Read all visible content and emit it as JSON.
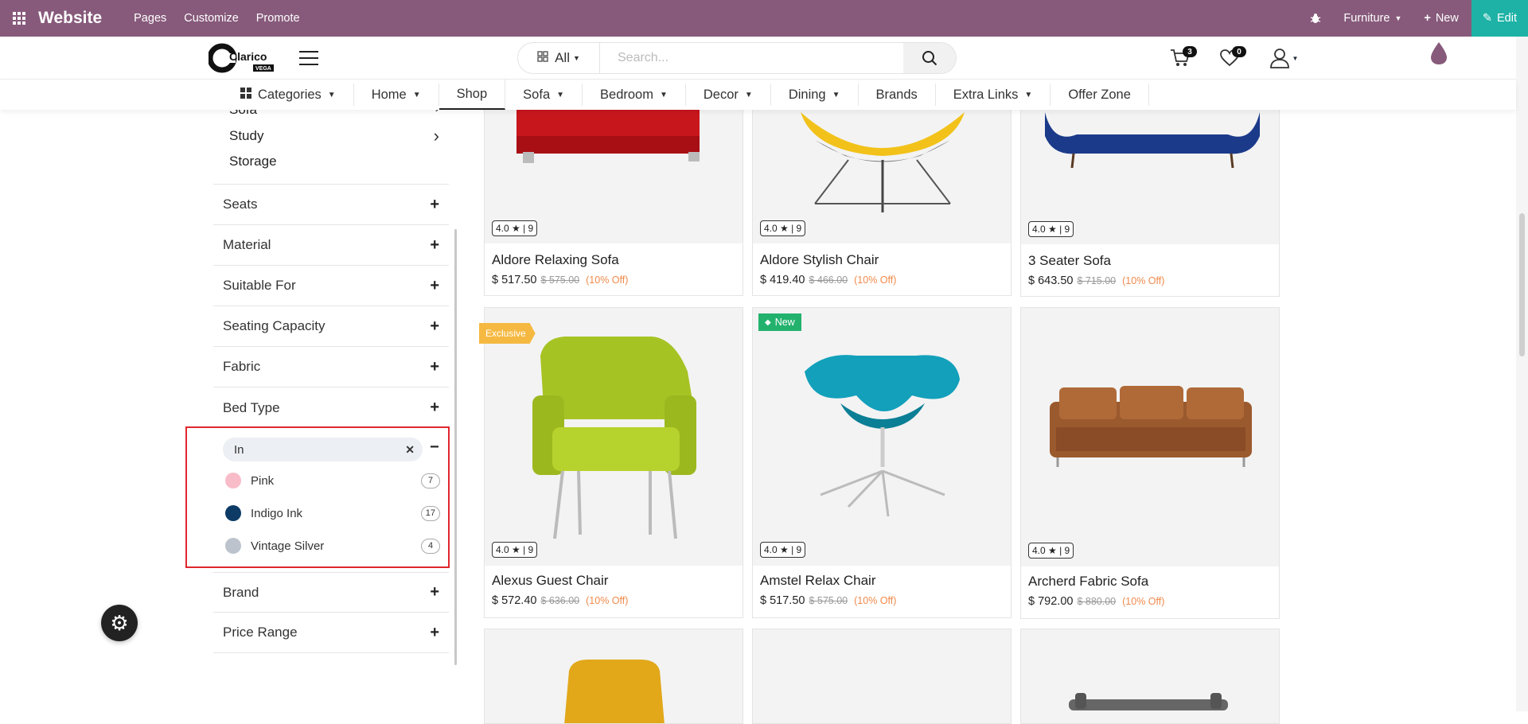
{
  "topbar": {
    "brand": "Website",
    "menu": [
      "Pages",
      "Customize",
      "Promote"
    ],
    "website_selector": "Furniture",
    "new_label": "New",
    "edit_label": "Edit",
    "color": "#875a7b",
    "edit_color": "#1eb2a6"
  },
  "header": {
    "logo_text": "Clarico",
    "logo_sub": "VEGA",
    "search_category": "All",
    "search_placeholder": "Search...",
    "cart_count": "3",
    "wishlist_count": "0"
  },
  "category_nav": [
    {
      "label": "Categories",
      "dropdown": true
    },
    {
      "label": "Home",
      "dropdown": true
    },
    {
      "label": "Shop",
      "dropdown": false,
      "active": true
    },
    {
      "label": "Sofa",
      "dropdown": true
    },
    {
      "label": "Bedroom",
      "dropdown": true
    },
    {
      "label": "Decor",
      "dropdown": true
    },
    {
      "label": "Dining",
      "dropdown": true
    },
    {
      "label": "Brands",
      "dropdown": false
    },
    {
      "label": "Extra Links",
      "dropdown": true
    },
    {
      "label": "Offer Zone",
      "dropdown": false
    }
  ],
  "sidebar": {
    "subcategories": [
      "Sofa",
      "Study",
      "Storage"
    ],
    "facets": [
      "Seats",
      "Material",
      "Suitable For",
      "Seating Capacity",
      "Fabric",
      "Bed Type"
    ],
    "color_filter": {
      "search_value": "In",
      "options": [
        {
          "name": "Pink",
          "count": "7",
          "color": "#f8bcc8"
        },
        {
          "name": "Indigo Ink",
          "count": "17",
          "color": "#0d3b66"
        },
        {
          "name": "Vintage Silver",
          "count": "4",
          "color": "#bcc3cc"
        }
      ]
    },
    "facets_after": [
      "Brand",
      "Price Range"
    ]
  },
  "products": [
    {
      "name": "Aldore Relaxing Sofa",
      "rating": "4.0 ★ | 9",
      "price": "$ 517.50",
      "old_price": "$ 575.00",
      "discount": "(10% Off)"
    },
    {
      "name": "Aldore Stylish Chair",
      "rating": "4.0 ★ | 9",
      "price": "$ 419.40",
      "old_price": "$ 466.00",
      "discount": "(10% Off)"
    },
    {
      "name": "3 Seater Sofa",
      "rating": "4.0 ★ | 9",
      "price": "$ 643.50",
      "old_price": "$ 715.00",
      "discount": "(10% Off)"
    },
    {
      "name": "Alexus Guest Chair",
      "rating": "4.0 ★ | 9",
      "price": "$ 572.40",
      "old_price": "$ 636.00",
      "discount": "(10% Off)",
      "ribbon": "Exclusive"
    },
    {
      "name": "Amstel Relax Chair",
      "rating": "4.0 ★ | 9",
      "price": "$ 517.50",
      "old_price": "$ 575.00",
      "discount": "(10% Off)",
      "ribbon": "New"
    },
    {
      "name": "Archerd Fabric Sofa",
      "rating": "4.0 ★ | 9",
      "price": "$ 792.00",
      "old_price": "$ 880.00",
      "discount": "(10% Off)"
    }
  ]
}
